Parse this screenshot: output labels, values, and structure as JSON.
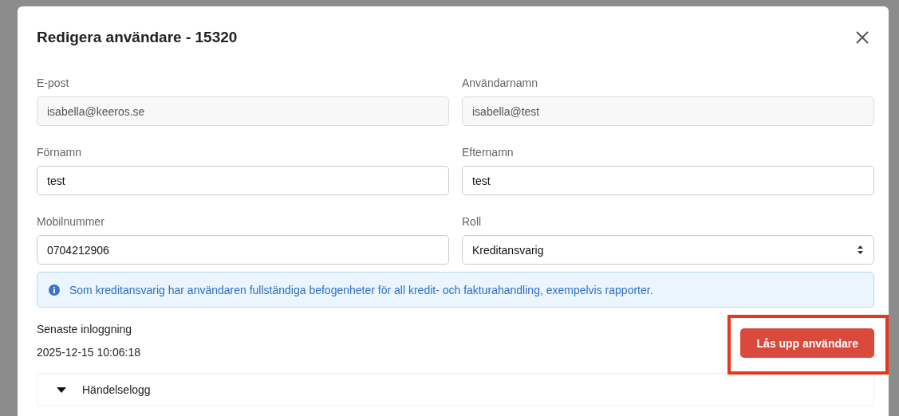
{
  "dialog": {
    "title": "Redigera användare - 15320",
    "fields": [
      {
        "label": "E-post",
        "kind": "text",
        "value": "isabella@keeros.se",
        "readonly": true
      },
      {
        "label": "Användarnamn",
        "kind": "text",
        "value": "isabella@test",
        "readonly": true
      },
      {
        "label": "Förnamn",
        "kind": "text",
        "value": "test",
        "readonly": false
      },
      {
        "label": "Efternamn",
        "kind": "text",
        "value": "test",
        "readonly": false
      },
      {
        "label": "Mobilnummer",
        "kind": "text",
        "value": "0704212906",
        "readonly": false
      },
      {
        "label": "Roll",
        "kind": "select",
        "value": "Kreditansvarig",
        "readonly": false
      }
    ],
    "info": "Som kreditansvarig har användaren fullständiga befogenheter för all kredit- och fakturahandling, exempelvis rapporter.",
    "last_login": {
      "label": "Senaste inloggning",
      "value": "2025-12-15 10:06:18"
    },
    "unlock_button": {
      "label": "Lås upp användare",
      "highlighted": true
    },
    "sections": [
      {
        "title": "Händelselogg",
        "expanded": false
      }
    ]
  }
}
